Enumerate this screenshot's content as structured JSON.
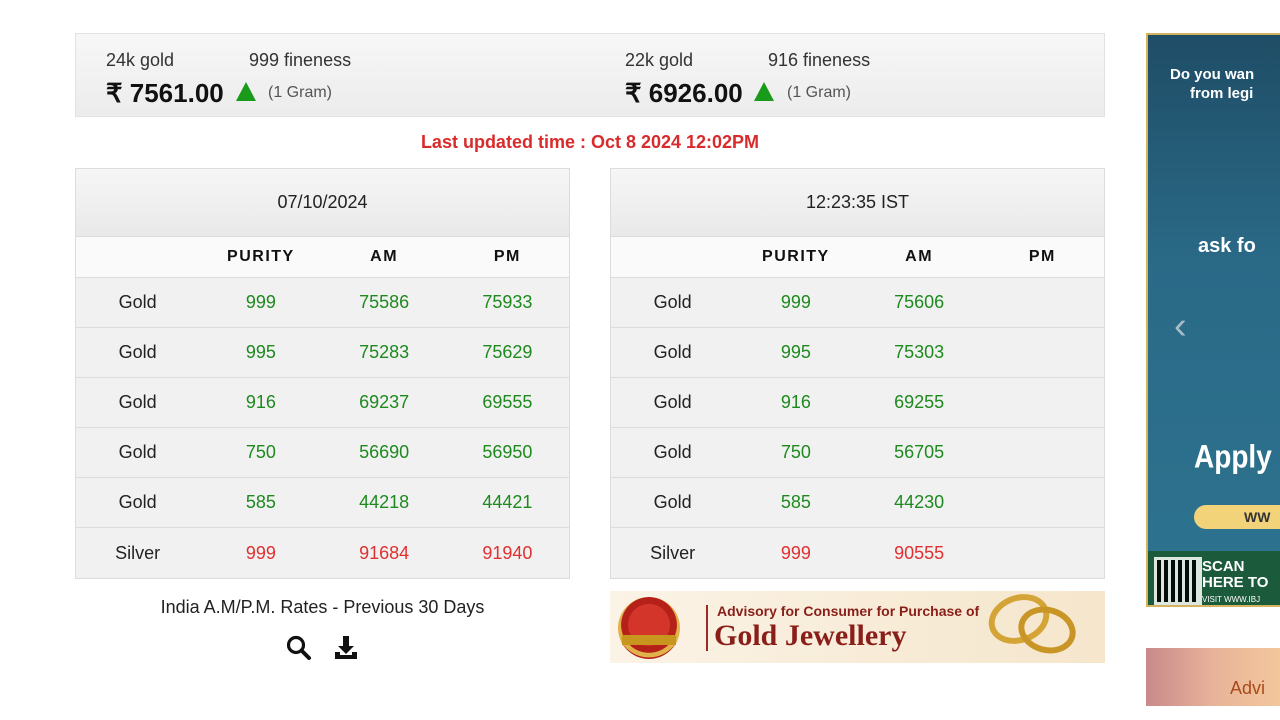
{
  "summary": {
    "gold24": {
      "karat": "24k gold",
      "fineness": "999 fineness",
      "price": "₹ 7561.00",
      "unit": "(1 Gram)",
      "trend": "up"
    },
    "gold22": {
      "karat": "22k gold",
      "fineness": "916 fineness",
      "price": "₹ 6926.00",
      "unit": "(1 Gram)",
      "trend": "up"
    }
  },
  "last_updated": "Last updated time : Oct 8 2024 12:02PM",
  "colors": {
    "up_arrow": "#1a9a1a",
    "updated_text": "#d92b2b",
    "gold_value": "#1e8a1e",
    "silver_value": "#e03030"
  },
  "table_left": {
    "heading": "07/10/2024",
    "columns": [
      "",
      "PURITY",
      "AM",
      "PM"
    ],
    "rows": [
      {
        "metal": "Gold",
        "purity": "999",
        "am": "75586",
        "pm": "75933"
      },
      {
        "metal": "Gold",
        "purity": "995",
        "am": "75283",
        "pm": "75629"
      },
      {
        "metal": "Gold",
        "purity": "916",
        "am": "69237",
        "pm": "69555"
      },
      {
        "metal": "Gold",
        "purity": "750",
        "am": "56690",
        "pm": "56950"
      },
      {
        "metal": "Gold",
        "purity": "585",
        "am": "44218",
        "pm": "44421"
      },
      {
        "metal": "Silver",
        "purity": "999",
        "am": "91684",
        "pm": "91940"
      }
    ]
  },
  "table_right": {
    "heading": "12:23:35 IST",
    "columns": [
      "",
      "PURITY",
      "AM",
      "PM"
    ],
    "rows": [
      {
        "metal": "Gold",
        "purity": "999",
        "am": "75606",
        "pm": ""
      },
      {
        "metal": "Gold",
        "purity": "995",
        "am": "75303",
        "pm": ""
      },
      {
        "metal": "Gold",
        "purity": "916",
        "am": "69255",
        "pm": ""
      },
      {
        "metal": "Gold",
        "purity": "750",
        "am": "56705",
        "pm": ""
      },
      {
        "metal": "Gold",
        "purity": "585",
        "am": "44230",
        "pm": ""
      },
      {
        "metal": "Silver",
        "purity": "999",
        "am": "90555",
        "pm": ""
      }
    ]
  },
  "previous_rates": {
    "label": "India A.M/P.M. Rates - Previous 30 Days",
    "search_icon": "search-icon",
    "download_icon": "download-icon"
  },
  "advisory_banner": {
    "subtitle": "Advisory for Consumer for Purchase of",
    "title": "Gold Jewellery"
  },
  "side_ad": {
    "line1": "Do you wan",
    "line2": "from legi",
    "ask": "ask fo",
    "apply": "Apply I",
    "pill": "WW",
    "scan1": "SCAN",
    "scan2": "HERE TO",
    "url": "VISIT WWW.IBJ",
    "prev_icon": "chevron-left-icon"
  },
  "side_ad2": {
    "text": "Advi"
  }
}
